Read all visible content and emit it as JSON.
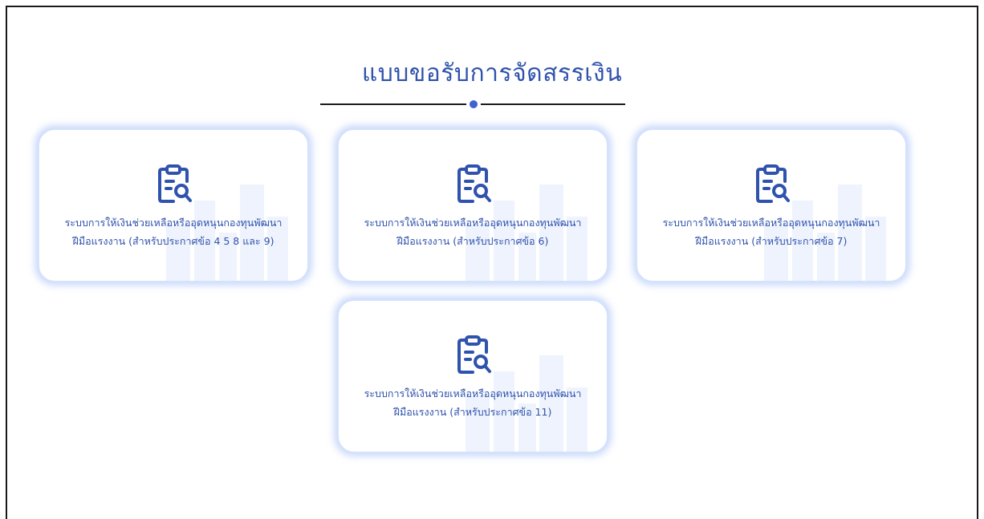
{
  "page": {
    "title": "แบบขอรับการจัดสรรเงิน"
  },
  "colors": {
    "accent": "#2f52ad",
    "card_border": "#d5e2fb"
  },
  "cards": [
    {
      "icon": "clipboard-search-icon",
      "line1": "ระบบการให้เงินช่วยเหลือหรืออุดหนุนกองทุนพัฒนา",
      "line2": "ฝีมือแรงงาน (สำหรับประกาศข้อ 4 5 8 และ 9)"
    },
    {
      "icon": "clipboard-search-icon",
      "line1": "ระบบการให้เงินช่วยเหลือหรืออุดหนุนกองทุนพัฒนา",
      "line2": "ฝีมือแรงงาน (สำหรับประกาศข้อ 6)"
    },
    {
      "icon": "clipboard-search-icon",
      "line1": "ระบบการให้เงินช่วยเหลือหรืออุดหนุนกองทุนพัฒนา",
      "line2": "ฝีมือแรงงาน (สำหรับประกาศข้อ 7)"
    },
    {
      "icon": "clipboard-search-icon",
      "line1": "ระบบการให้เงินช่วยเหลือหรืออุดหนุนกองทุนพัฒนา",
      "line2": "ฝีมือแรงงาน (สำหรับประกาศข้อ 11)"
    }
  ]
}
